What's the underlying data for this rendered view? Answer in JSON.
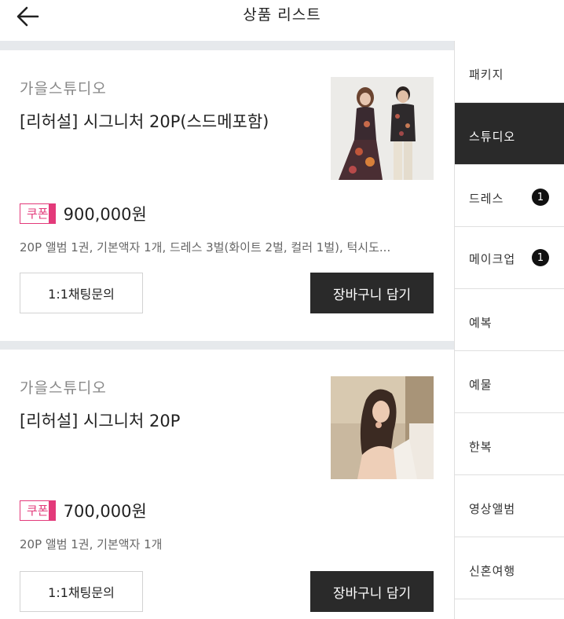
{
  "header": {
    "title": "상품 리스트",
    "back_icon": "arrow-left-icon"
  },
  "products": [
    {
      "vendor": "가을스튜디오",
      "title": "[리허설] 시그니처 20P(스드메포함)",
      "coupon_label": "쿠폰",
      "price": "900,000원",
      "description": "20P 앨범 1권, 기본액자 1개, 드레스 3벌(화이트 2벌, 컬러 1벌), 턱시도...",
      "chat_label": "1:1채팅문의",
      "cart_label": "장바구니 담기"
    },
    {
      "vendor": "가을스튜디오",
      "title": "[리허설] 시그니처 20P",
      "coupon_label": "쿠폰",
      "price": "700,000원",
      "description": "20P 앨범 1권, 기본액자 1개",
      "chat_label": "1:1채팅문의",
      "cart_label": "장바구니 담기"
    }
  ],
  "categories": [
    {
      "label": "패키지",
      "active": false
    },
    {
      "label": "스튜디오",
      "active": true
    },
    {
      "label": "드레스",
      "active": false,
      "badge": "1"
    },
    {
      "label": "메이크업",
      "active": false,
      "badge": "1"
    },
    {
      "label": "예복",
      "active": false
    },
    {
      "label": "예물",
      "active": false
    },
    {
      "label": "한복",
      "active": false
    },
    {
      "label": "영상앨범",
      "active": false
    },
    {
      "label": "신혼여행",
      "active": false
    }
  ],
  "colors": {
    "accent": "#e33a7a",
    "dark": "#2a2a2a",
    "divider": "#e6e9ec"
  }
}
